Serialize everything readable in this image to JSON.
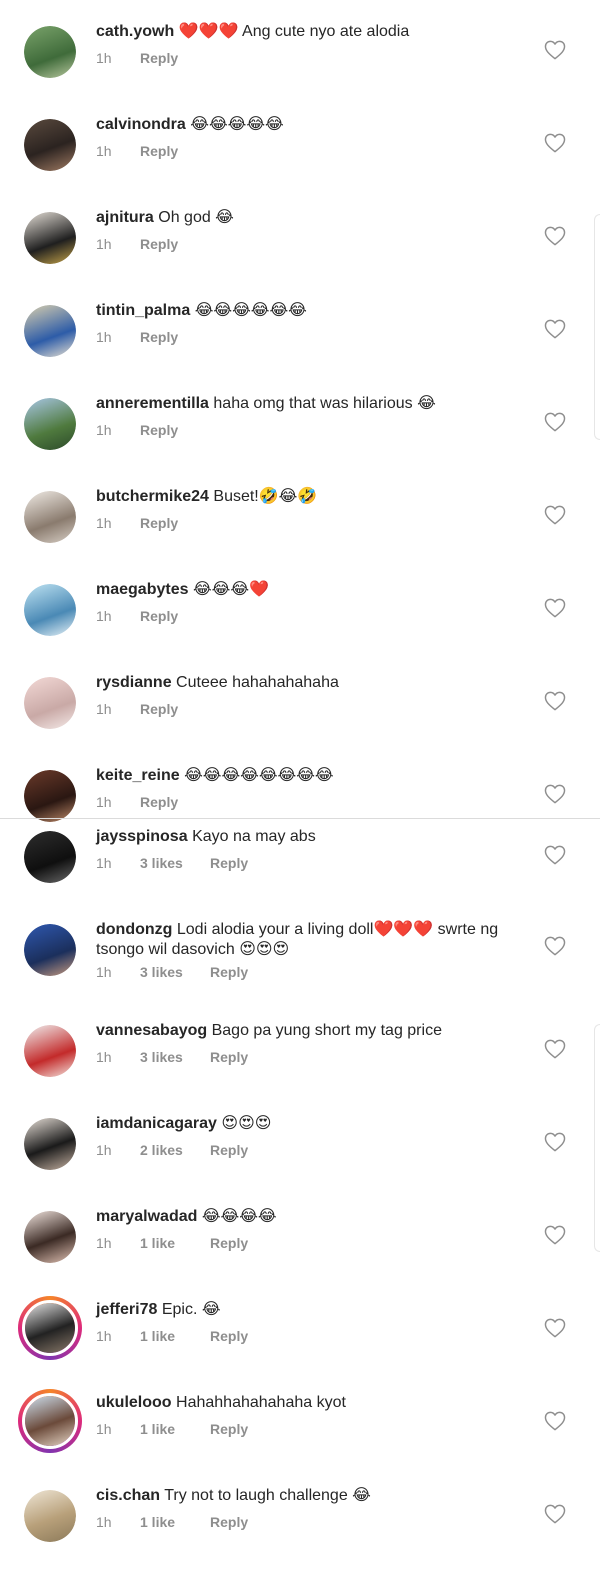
{
  "comments": [
    {
      "username": "cath.yowh",
      "text": "❤️❤️❤️ Ang cute nyo ate alodia",
      "time": "1h",
      "likes": "",
      "reply": "Reply"
    },
    {
      "username": "calvinondra",
      "text": "😂😂😂😂😂",
      "time": "1h",
      "likes": "",
      "reply": "Reply"
    },
    {
      "username": "ajnitura",
      "text": "Oh god 😂",
      "time": "1h",
      "likes": "",
      "reply": "Reply"
    },
    {
      "username": "tintin_palma",
      "text": "😂😂😂😂😂😂",
      "time": "1h",
      "likes": "",
      "reply": "Reply"
    },
    {
      "username": "annerementilla",
      "text": "haha omg that was hilarious 😂",
      "time": "1h",
      "likes": "",
      "reply": "Reply"
    },
    {
      "username": "butchermike24",
      "text": "Buset!🤣😂🤣",
      "time": "1h",
      "likes": "",
      "reply": "Reply"
    },
    {
      "username": "maegabytes",
      "text": "😂😂😂❤️",
      "time": "1h",
      "likes": "",
      "reply": "Reply"
    },
    {
      "username": "rysdianne",
      "text": "Cuteee hahahahahaha",
      "time": "1h",
      "likes": "",
      "reply": "Reply"
    },
    {
      "username": "keite_reine",
      "text": "😂😂😂😂😂😂😂😂",
      "time": "1h",
      "likes": "",
      "reply": "Reply"
    },
    {
      "username": "jaysspinosa",
      "text": "Kayo na may abs",
      "time": "1h",
      "likes": "3 likes",
      "reply": "Reply"
    },
    {
      "username": "dondonzg",
      "text": "Lodi alodia your a living doll❤️❤️❤️ swrte ng tsongo wil dasovich 😍😍😍",
      "time": "1h",
      "likes": "3 likes",
      "reply": "Reply"
    },
    {
      "username": "vannesabayog",
      "text": "Bago pa yung short my tag price",
      "time": "1h",
      "likes": "3 likes",
      "reply": "Reply"
    },
    {
      "username": "iamdanicagaray",
      "text": "😍😍😍",
      "time": "1h",
      "likes": "2 likes",
      "reply": "Reply"
    },
    {
      "username": "maryalwadad",
      "text": "😂😂😂😂",
      "time": "1h",
      "likes": "1 like",
      "reply": "Reply"
    },
    {
      "username": "jefferi78",
      "text": "Epic. 😂",
      "time": "1h",
      "likes": "1 like",
      "reply": "Reply"
    },
    {
      "username": "ukulelooo",
      "text": "Hahahhahahahaha kyot",
      "time": "1h",
      "likes": "1 like",
      "reply": "Reply"
    },
    {
      "username": "cis.chan",
      "text": "Try not to laugh challenge 😂",
      "time": "1h",
      "likes": "1 like",
      "reply": "Reply"
    }
  ],
  "icons": {
    "heart": "heart-outline-icon",
    "avatar": "user-avatar"
  },
  "colors": {
    "text": "#262626",
    "muted": "#8e8e8e",
    "divider": "#dbdbdb"
  }
}
